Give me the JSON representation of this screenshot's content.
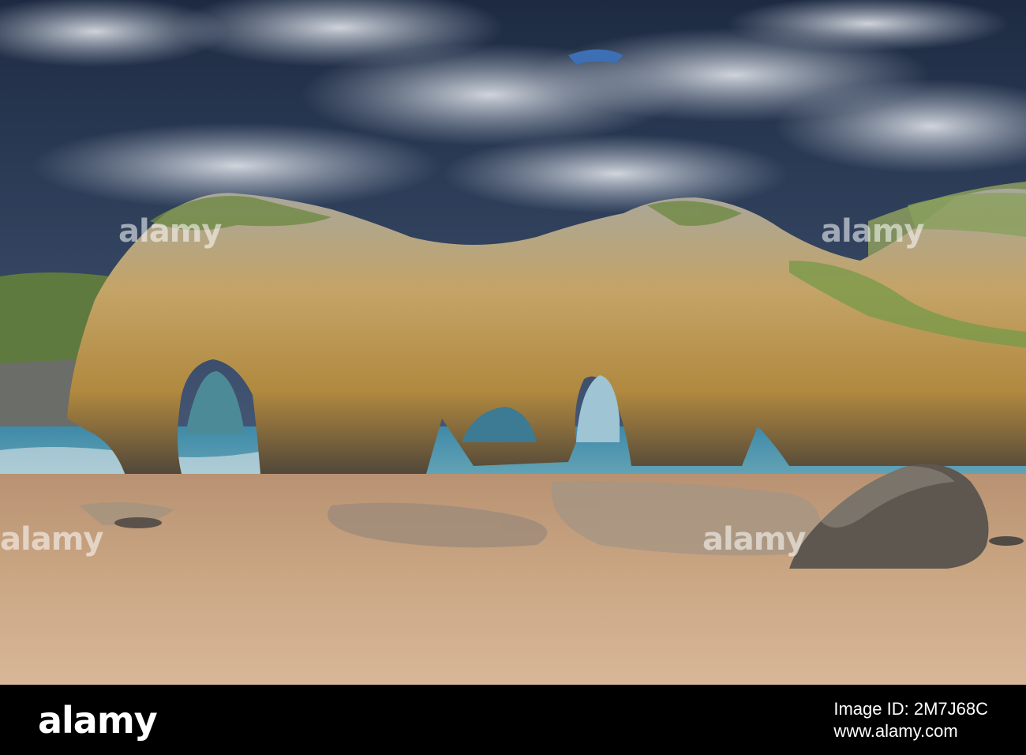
{
  "watermark": {
    "brand": "alamy",
    "overlay_text": "alamy"
  },
  "footer": {
    "logo": "alamy",
    "image_label": "Image ID: 2M7J68C",
    "url": "www.alamy.com"
  },
  "colors": {
    "sky_dark": "#24314a",
    "cloud": "#d8dde6",
    "rock_ochre": "#c9a35f",
    "rock_grey": "#8d8e86",
    "grass": "#6f8a45",
    "sea": "#3f8aa8",
    "sand": "#c9a27a"
  }
}
